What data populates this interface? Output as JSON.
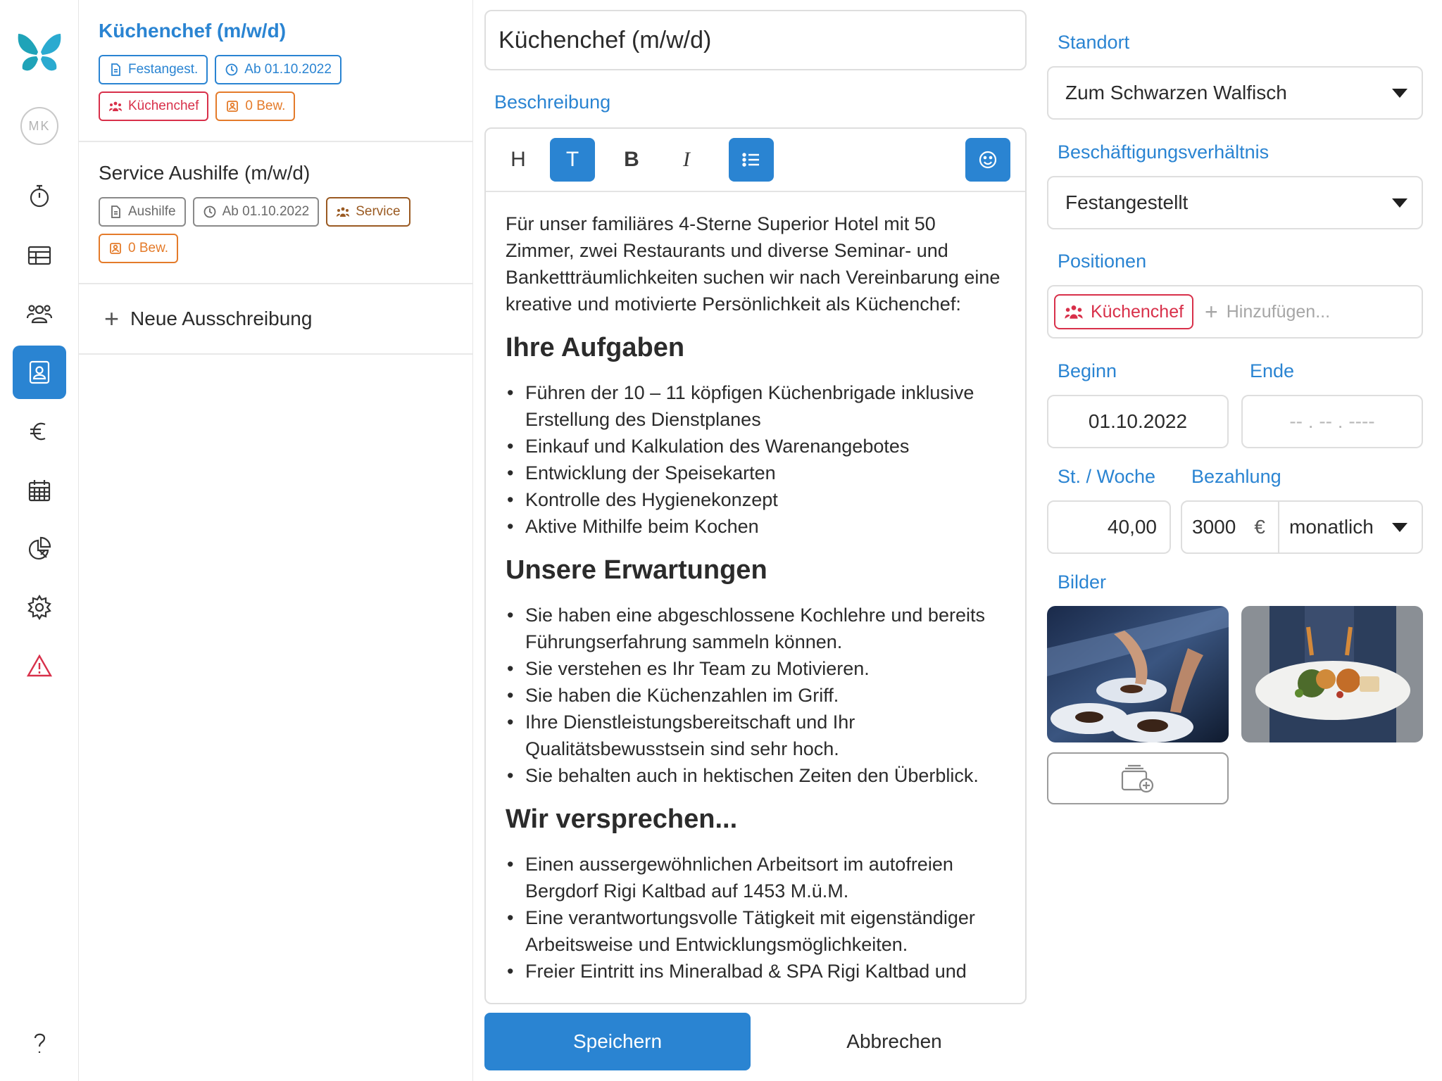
{
  "user": {
    "initials": "MK"
  },
  "nav": [
    {
      "name": "timer-icon"
    },
    {
      "name": "table-icon"
    },
    {
      "name": "team-icon"
    },
    {
      "name": "job-postings-icon",
      "active": true
    },
    {
      "name": "euro-icon"
    },
    {
      "name": "calendar-icon"
    },
    {
      "name": "pie-chart-icon"
    },
    {
      "name": "gear-icon"
    },
    {
      "name": "warning-icon"
    },
    {
      "name": "help-icon"
    }
  ],
  "jobs": [
    {
      "title": "Küchenchef (m/w/d)",
      "selected": true,
      "tags": {
        "type": "Festangest.",
        "start": "Ab 01.10.2022",
        "position": "Küchenchef",
        "applicants": "0 Bew."
      }
    },
    {
      "title": "Service Aushilfe (m/w/d)",
      "selected": false,
      "tags": {
        "type": "Aushilfe",
        "start": "Ab 01.10.2022",
        "position": "Service",
        "applicants": "0 Bew."
      }
    }
  ],
  "new_job_label": "Neue Ausschreibung",
  "editor": {
    "title_value": "Küchenchef (m/w/d)",
    "description_label": "Beschreibung",
    "toolbar": {
      "heading": "H",
      "text": "T",
      "bold": "B",
      "italic": "I"
    },
    "intro": "Für unser familiäres 4-Sterne Superior Hotel mit 50 Zimmer, zwei Restaurants und diverse Seminar- und Bankettträumlichkeiten suchen wir nach Vereinbarung eine kreative und motivierte Persönlichkeit als Küchenchef:",
    "sections": [
      {
        "heading": "Ihre Aufgaben",
        "items": [
          "Führen der 10 – 11 köpfigen Küchenbrigade inklusive Erstellung des Dienstplanes",
          "Einkauf und Kalkulation des Warenangebotes",
          "Entwicklung der Speisekarten",
          "Kontrolle des Hygienekonzept",
          "Aktive Mithilfe beim Kochen"
        ]
      },
      {
        "heading": "Unsere Erwartungen",
        "items": [
          "Sie haben eine abgeschlossene Kochlehre und bereits Führungserfahrung sammeln können.",
          "Sie verstehen es Ihr Team zu Motivieren.",
          "Sie haben die Küchenzahlen im Griff.",
          "Ihre Dienstleistungsbereitschaft und Ihr Qualitätsbewusstsein sind sehr hoch.",
          "Sie behalten auch in hektischen Zeiten den Überblick."
        ]
      },
      {
        "heading": "Wir versprechen...",
        "items": [
          "Einen aussergewöhnlichen Arbeitsort im autofreien Bergdorf Rigi Kaltbad auf 1453 M.ü.M.",
          "Eine verantwortungsvolle Tätigkeit mit eigenständiger Arbeitsweise und Entwicklungsmöglichkeiten.",
          "Freier Eintritt ins Mineralbad & SPA Rigi Kaltbad und"
        ]
      }
    ],
    "save_label": "Speichern",
    "cancel_label": "Abbrechen"
  },
  "form": {
    "location_label": "Standort",
    "location_value": "Zum Schwarzen Walfisch",
    "employment_label": "Beschäftigungsverhältnis",
    "employment_value": "Festangestellt",
    "positions_label": "Positionen",
    "position_chip": "Küchenchef",
    "add_placeholder": "Hinzufügen...",
    "start_label": "Beginn",
    "start_value": "01.10.2022",
    "end_label": "Ende",
    "end_placeholder": "-- . -- . ----",
    "hours_label": "St. / Woche",
    "hours_value": "40,00",
    "pay_label": "Bezahlung",
    "pay_value": "3000",
    "currency": "€",
    "pay_period": "monatlich",
    "images_label": "Bilder"
  },
  "colors": {
    "accent": "#2a84d2",
    "position_red": "#d8304a",
    "applicants_orange": "#e47b2a",
    "service_brown": "#9a5a22",
    "warning_red": "#d8304a"
  }
}
